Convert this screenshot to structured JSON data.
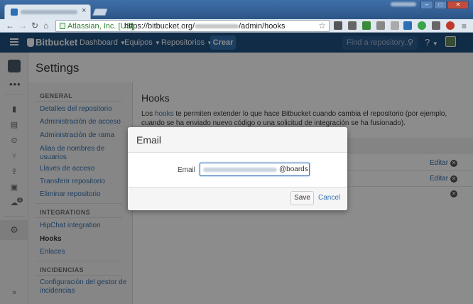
{
  "browser": {
    "ev_label": "Atlassian, Inc. [US]",
    "url_prefix": "https://bitbucket.org/",
    "url_suffix": "/admin/hooks",
    "tab_close": "×"
  },
  "header": {
    "logo": "Bitbucket",
    "nav": [
      "Dashboard",
      "Equipos",
      "Repositorios"
    ],
    "create_label": "Crear",
    "search_placeholder": "Find a repository...",
    "help_icon": "?"
  },
  "rail": {
    "more": "•••",
    "badge": "1"
  },
  "page": {
    "title": "Settings",
    "sidebar": {
      "general_title": "GENERAL",
      "general_items": [
        "Detalles del repositorio",
        "Administración de acceso",
        "Administración de rama",
        "Alias de nombres de usuarios",
        "Llaves de acceso",
        "Transferir repositorio",
        "Eliminar repositorio"
      ],
      "integrations_title": "INTEGRATIONS",
      "integrations_items": [
        "HipChat integration",
        "Hooks",
        "Enlaces"
      ],
      "incidencias_title": "INCIDENCIAS",
      "incidencias_items": [
        "Configuración del gestor de incidencias"
      ]
    },
    "main": {
      "title": "Hooks",
      "desc_pre": "Los ",
      "desc_link": "hooks",
      "desc_post": " te permiten extender lo que hace Bitbucket cuando cambia el repositorio (por ejemplo, cuando se ha enviado nuevo código o una solicitud de integración se ha fusionado).",
      "edit_label": "Editar"
    }
  },
  "dialog": {
    "title": "Email",
    "field_label": "Email",
    "field_suffix": "@boards",
    "save_label": "Save",
    "cancel_label": "Cancel"
  },
  "colors": {
    "header_bg": "#205081",
    "link": "#3572b0",
    "create_btn": "#3572b0"
  }
}
